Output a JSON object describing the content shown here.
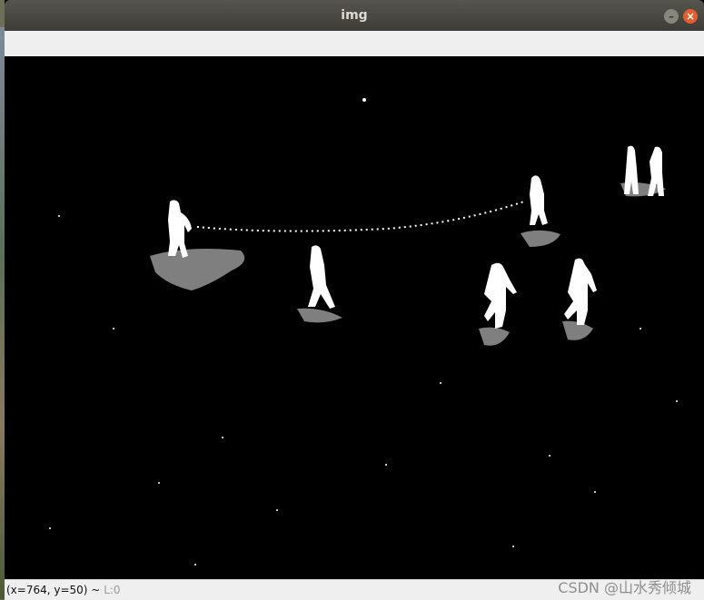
{
  "window": {
    "title": "img",
    "minimize_icon": "minimize-icon",
    "close_icon": "close-icon"
  },
  "image": {
    "description_colors": {
      "background": "#000000",
      "foreground": "#ffffff",
      "shadow": "#7f7f7f"
    }
  },
  "statusbar": {
    "coords": "(x=764, y=50) ~",
    "level": "L:0"
  },
  "watermark": "CSDN @山水秀倾城"
}
